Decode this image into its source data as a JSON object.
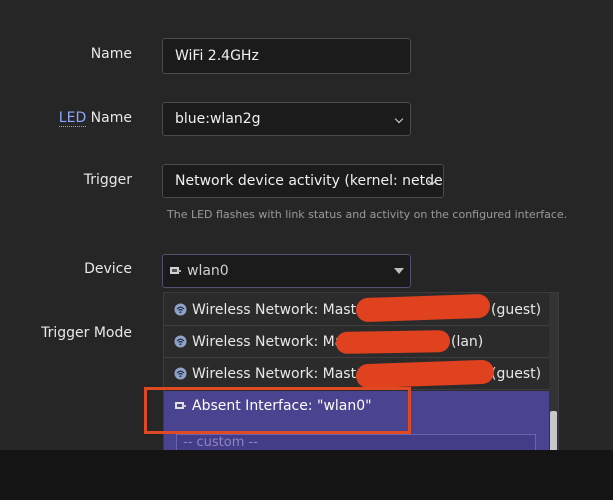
{
  "form": {
    "name": {
      "label": "Name",
      "value": "WiFi 2.4GHz"
    },
    "led_name": {
      "label_abbr": "LED",
      "label_rest": " Name",
      "value": "blue:wlan2g"
    },
    "trigger": {
      "label": "Trigger",
      "value": "Network device activity (kernel: netdev)",
      "hint": "The LED flashes with link status and activity on the configured interface."
    },
    "device": {
      "label": "Device",
      "value": "wlan0"
    },
    "trigger_mode": {
      "label": "Trigger Mode"
    }
  },
  "dropdown": {
    "options": [
      {
        "prefix": "Wireless Network: Master",
        "suffix": "(guest)"
      },
      {
        "prefix": "Wireless Network: Maste",
        "suffix": "(lan)"
      },
      {
        "prefix": "Wireless Network: Master \"",
        "suffix": "(guest)"
      },
      {
        "prefix": "Absent Interface: \"wlan0\"",
        "suffix": ""
      }
    ],
    "custom_placeholder": "-- custom --"
  },
  "colors": {
    "background": "#262626",
    "selected_option": "#4a438f",
    "annotation": "#e04a22",
    "redaction": "#e0421f"
  }
}
